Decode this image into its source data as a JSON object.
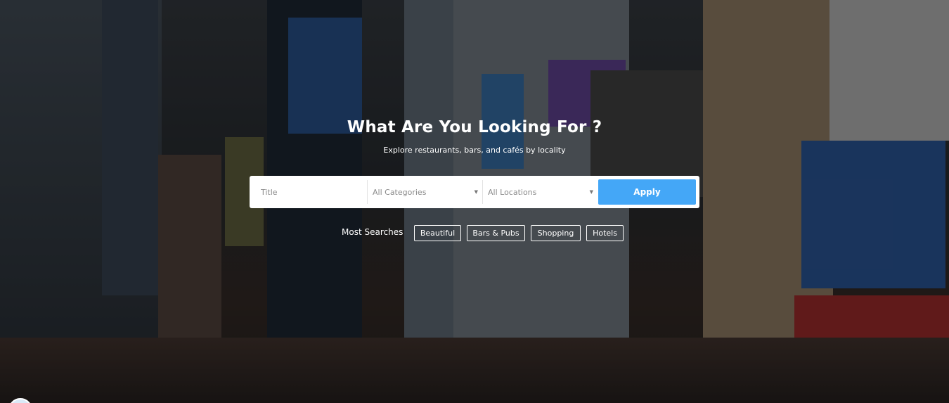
{
  "hero": {
    "title": "What Are You Looking For ?",
    "subtitle": "Explore restaurants, bars, and cafés by locality"
  },
  "search": {
    "title_placeholder": "Title",
    "category_value": "All Categories",
    "location_value": "All Locations",
    "apply_label": "Apply",
    "apply_color": "#44a7f7"
  },
  "most_searches": {
    "label": "Most Searches",
    "tags": [
      "Beautiful",
      "Bars & Pubs",
      "Shopping",
      "Hotels"
    ]
  },
  "icons": {
    "dropdown": "chevron-down-icon"
  }
}
